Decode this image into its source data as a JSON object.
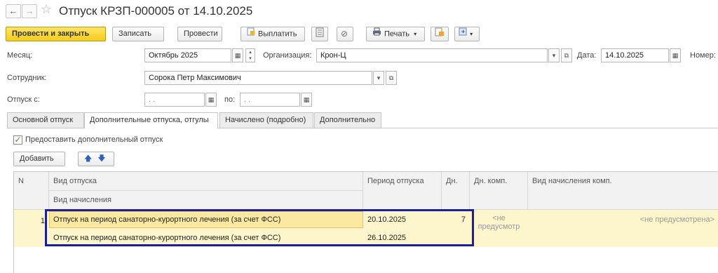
{
  "window": {
    "back": "←",
    "forward": "→",
    "title": "Отпуск КРЗП-000005 от 14.10.2025"
  },
  "toolbar": {
    "post_close": "Провести и закрыть",
    "save": "Записать",
    "post": "Провести",
    "pay": "Выплатить",
    "print": "Печать"
  },
  "form": {
    "month_label": "Месяц:",
    "month_value": "Октябрь 2025",
    "org_label": "Организация:",
    "org_value": "Крон-Ц",
    "date_label": "Дата:",
    "date_value": "14.10.2025",
    "number_label": "Номер:",
    "employee_label": "Сотрудник:",
    "employee_value": "Сорока Петр Максимович",
    "vacation_from_label": "Отпуск с:",
    "from_value": " .  .",
    "to_label": "по:",
    "to_value": " .  ."
  },
  "tabs": [
    {
      "label": "Основной отпуск"
    },
    {
      "label": "Дополнительные отпуска, отгулы"
    },
    {
      "label": "Начислено (подробно)"
    },
    {
      "label": "Дополнительно"
    }
  ],
  "extra": {
    "checkbox_label": "Предоставить дополнительный отпуск",
    "checked": true,
    "add_button": "Добавить"
  },
  "grid": {
    "headers": {
      "n": "N",
      "type": "Вид отпуска",
      "accrual": "Вид начисления",
      "period": "Период отпуска",
      "days": "Дн.",
      "comp_days": "Дн. комп.",
      "comp_accrual": "Вид начисления комп."
    },
    "rows": [
      {
        "n": "1",
        "type": "Отпуск на период санаторно-курортного лечения (за счет ФСС)",
        "accrual": "Отпуск на период санаторно-курортного лечения (за счет ФСС)",
        "period_from": "20.10.2025",
        "period_to": "26.10.2025",
        "days": "7",
        "comp_days": "<не предусмотр",
        "comp_accrual": "<не предусмотрена>"
      }
    ]
  },
  "colors": {
    "primary_button": "#f4cc1b",
    "row_highlight": "#fdf5cc",
    "selection_border": "#1b1f9c"
  }
}
